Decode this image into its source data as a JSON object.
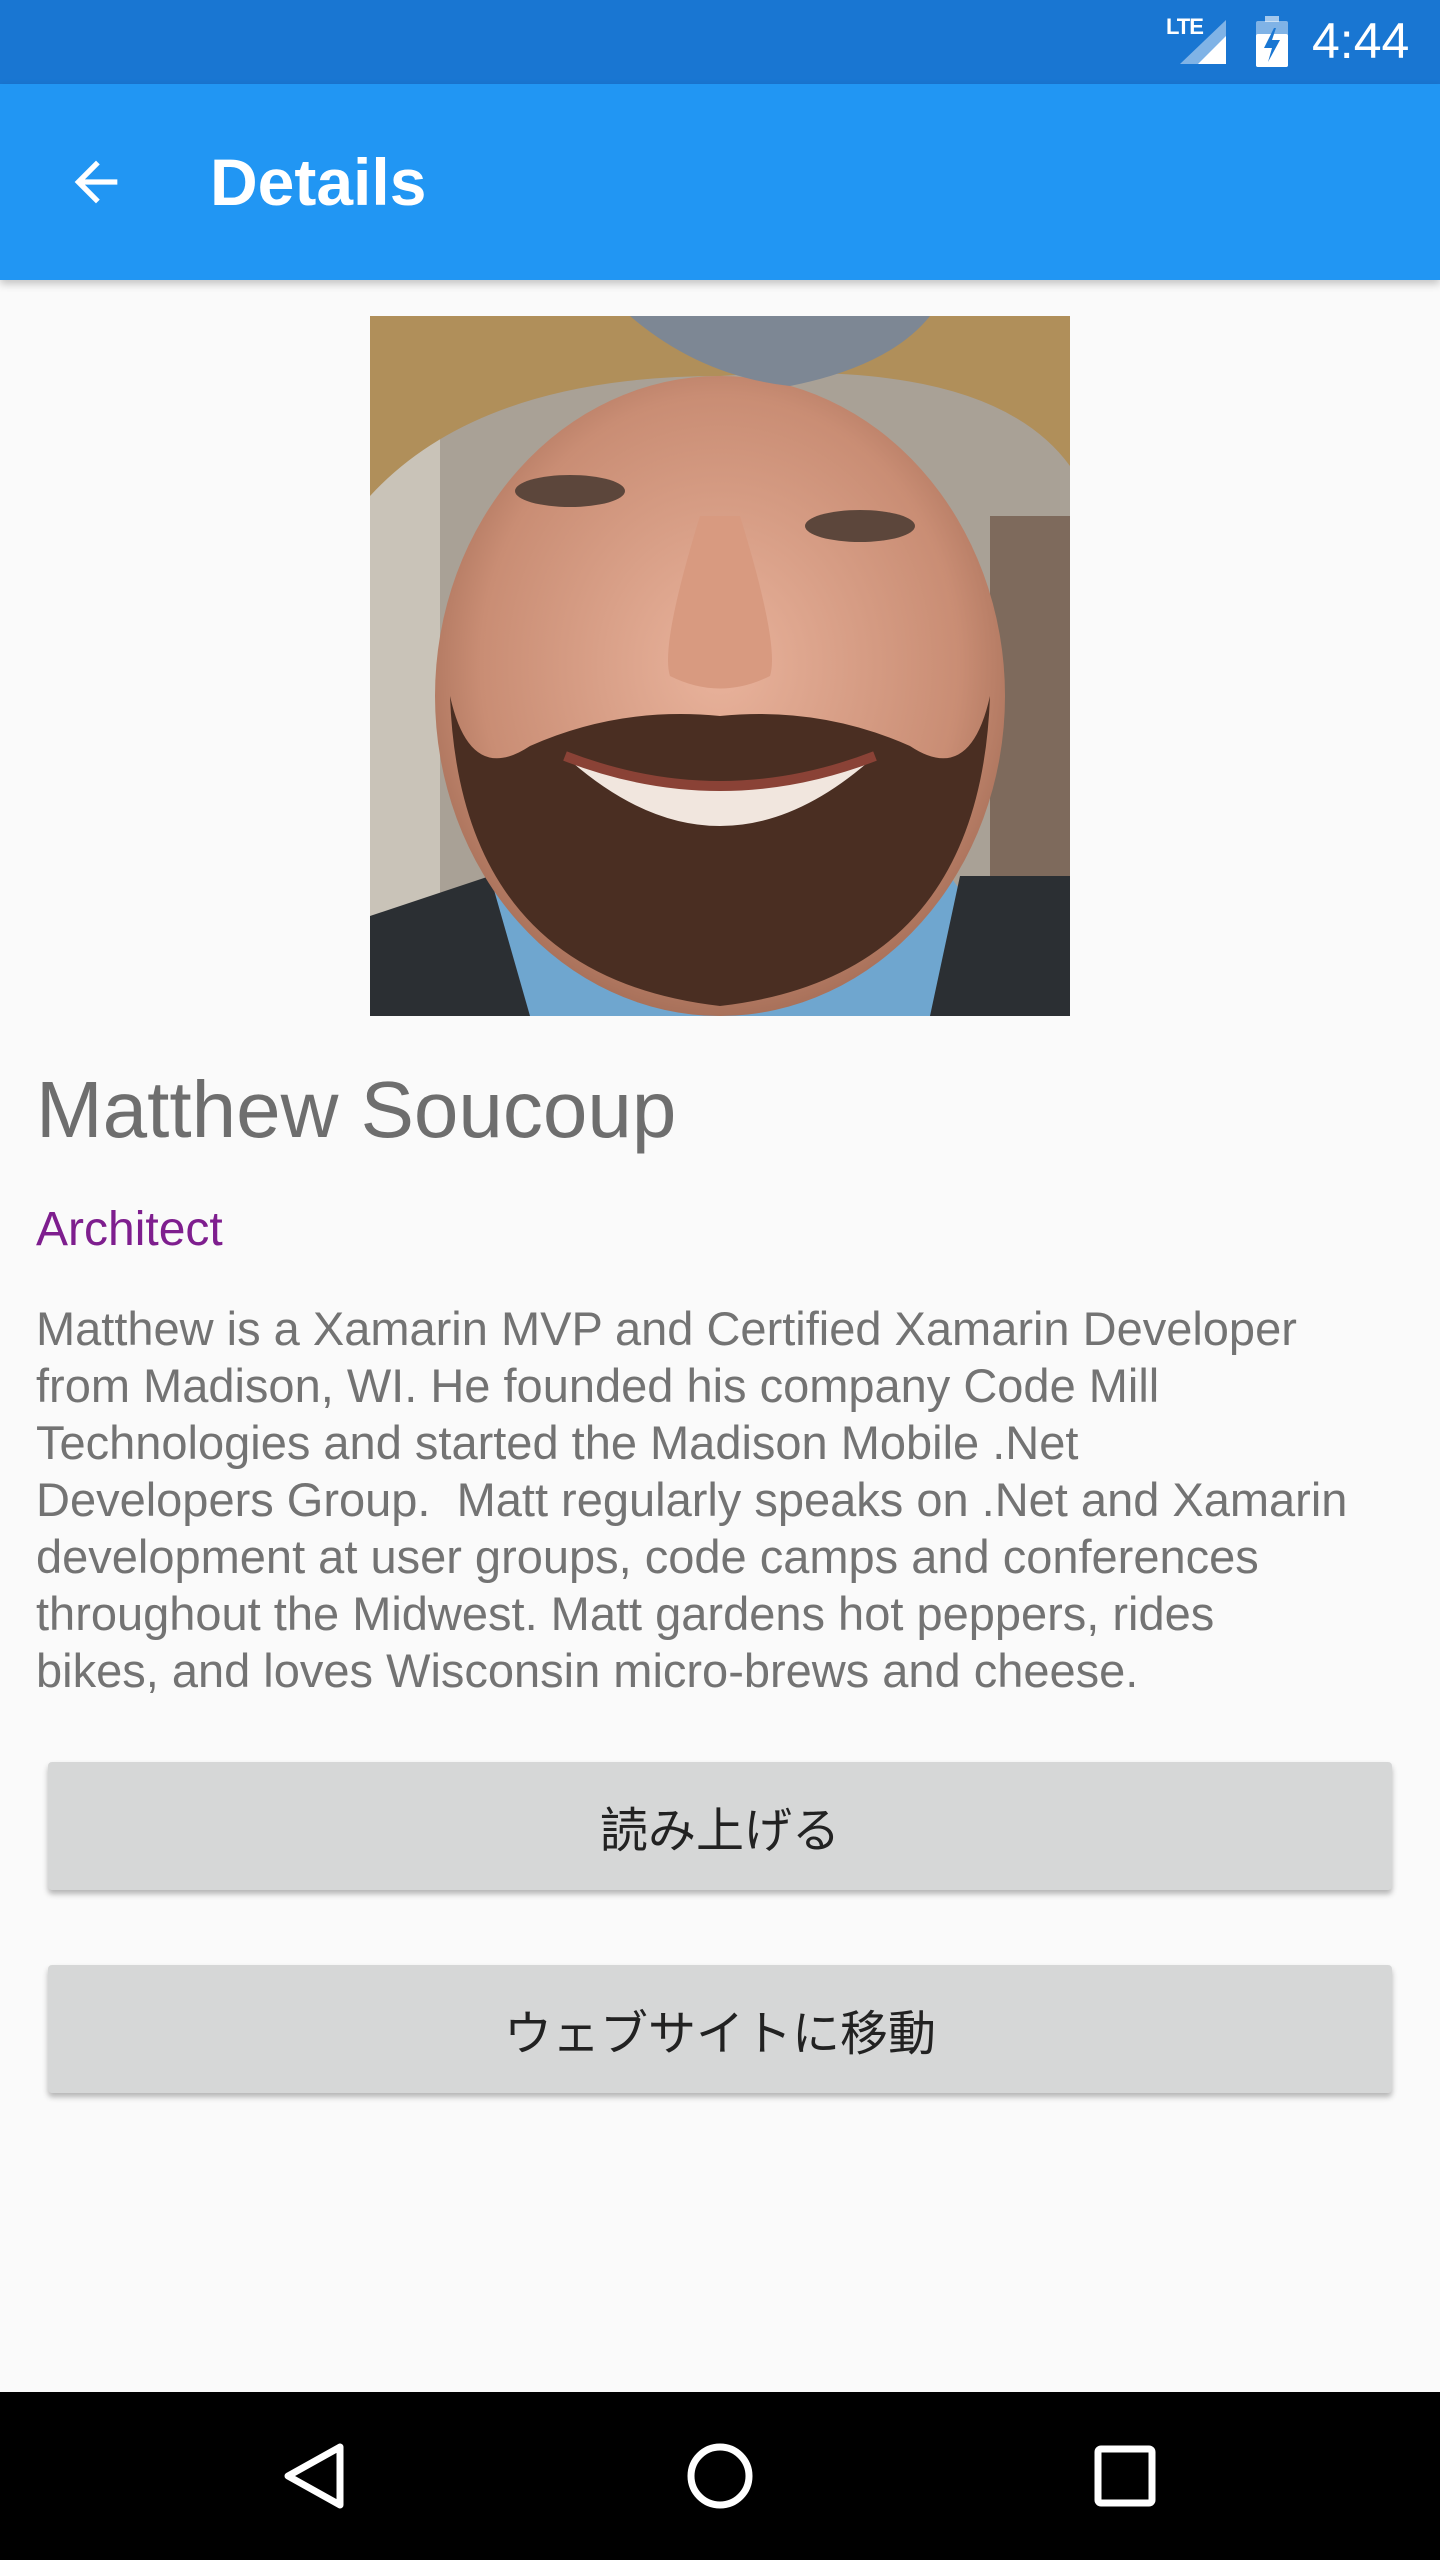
{
  "status_bar": {
    "network": "LTE",
    "time": "4:44",
    "icons": [
      "signal-icon",
      "battery-charging-icon"
    ]
  },
  "app_bar": {
    "title": "Details",
    "back_icon": "arrow-back-icon"
  },
  "profile": {
    "photo": "profile-photo",
    "name": "Matthew Soucoup",
    "role": "Architect",
    "bio": "Matthew is a Xamarin MVP and Certified Xamarin Developer\nfrom Madison, WI. He founded his company Code Mill\nTechnologies and started the Madison Mobile .Net\nDevelopers Group.  Matt regularly speaks on .Net and Xamarin\ndevelopment at user groups, code camps and conferences\nthroughout the Midwest. Matt gardens hot peppers, rides\nbikes, and loves Wisconsin micro-brews and cheese."
  },
  "buttons": {
    "read_aloud": "読み上げる",
    "go_to_website": "ウェブサイトに移動"
  },
  "nav_bar": {
    "icons": [
      "back-triangle-icon",
      "home-circle-icon",
      "recents-square-icon"
    ]
  },
  "colors": {
    "status_bar": "#1976d2",
    "app_bar": "#2196f3",
    "role_text": "#7e1e8e",
    "button_bg": "#d6d7d7"
  }
}
